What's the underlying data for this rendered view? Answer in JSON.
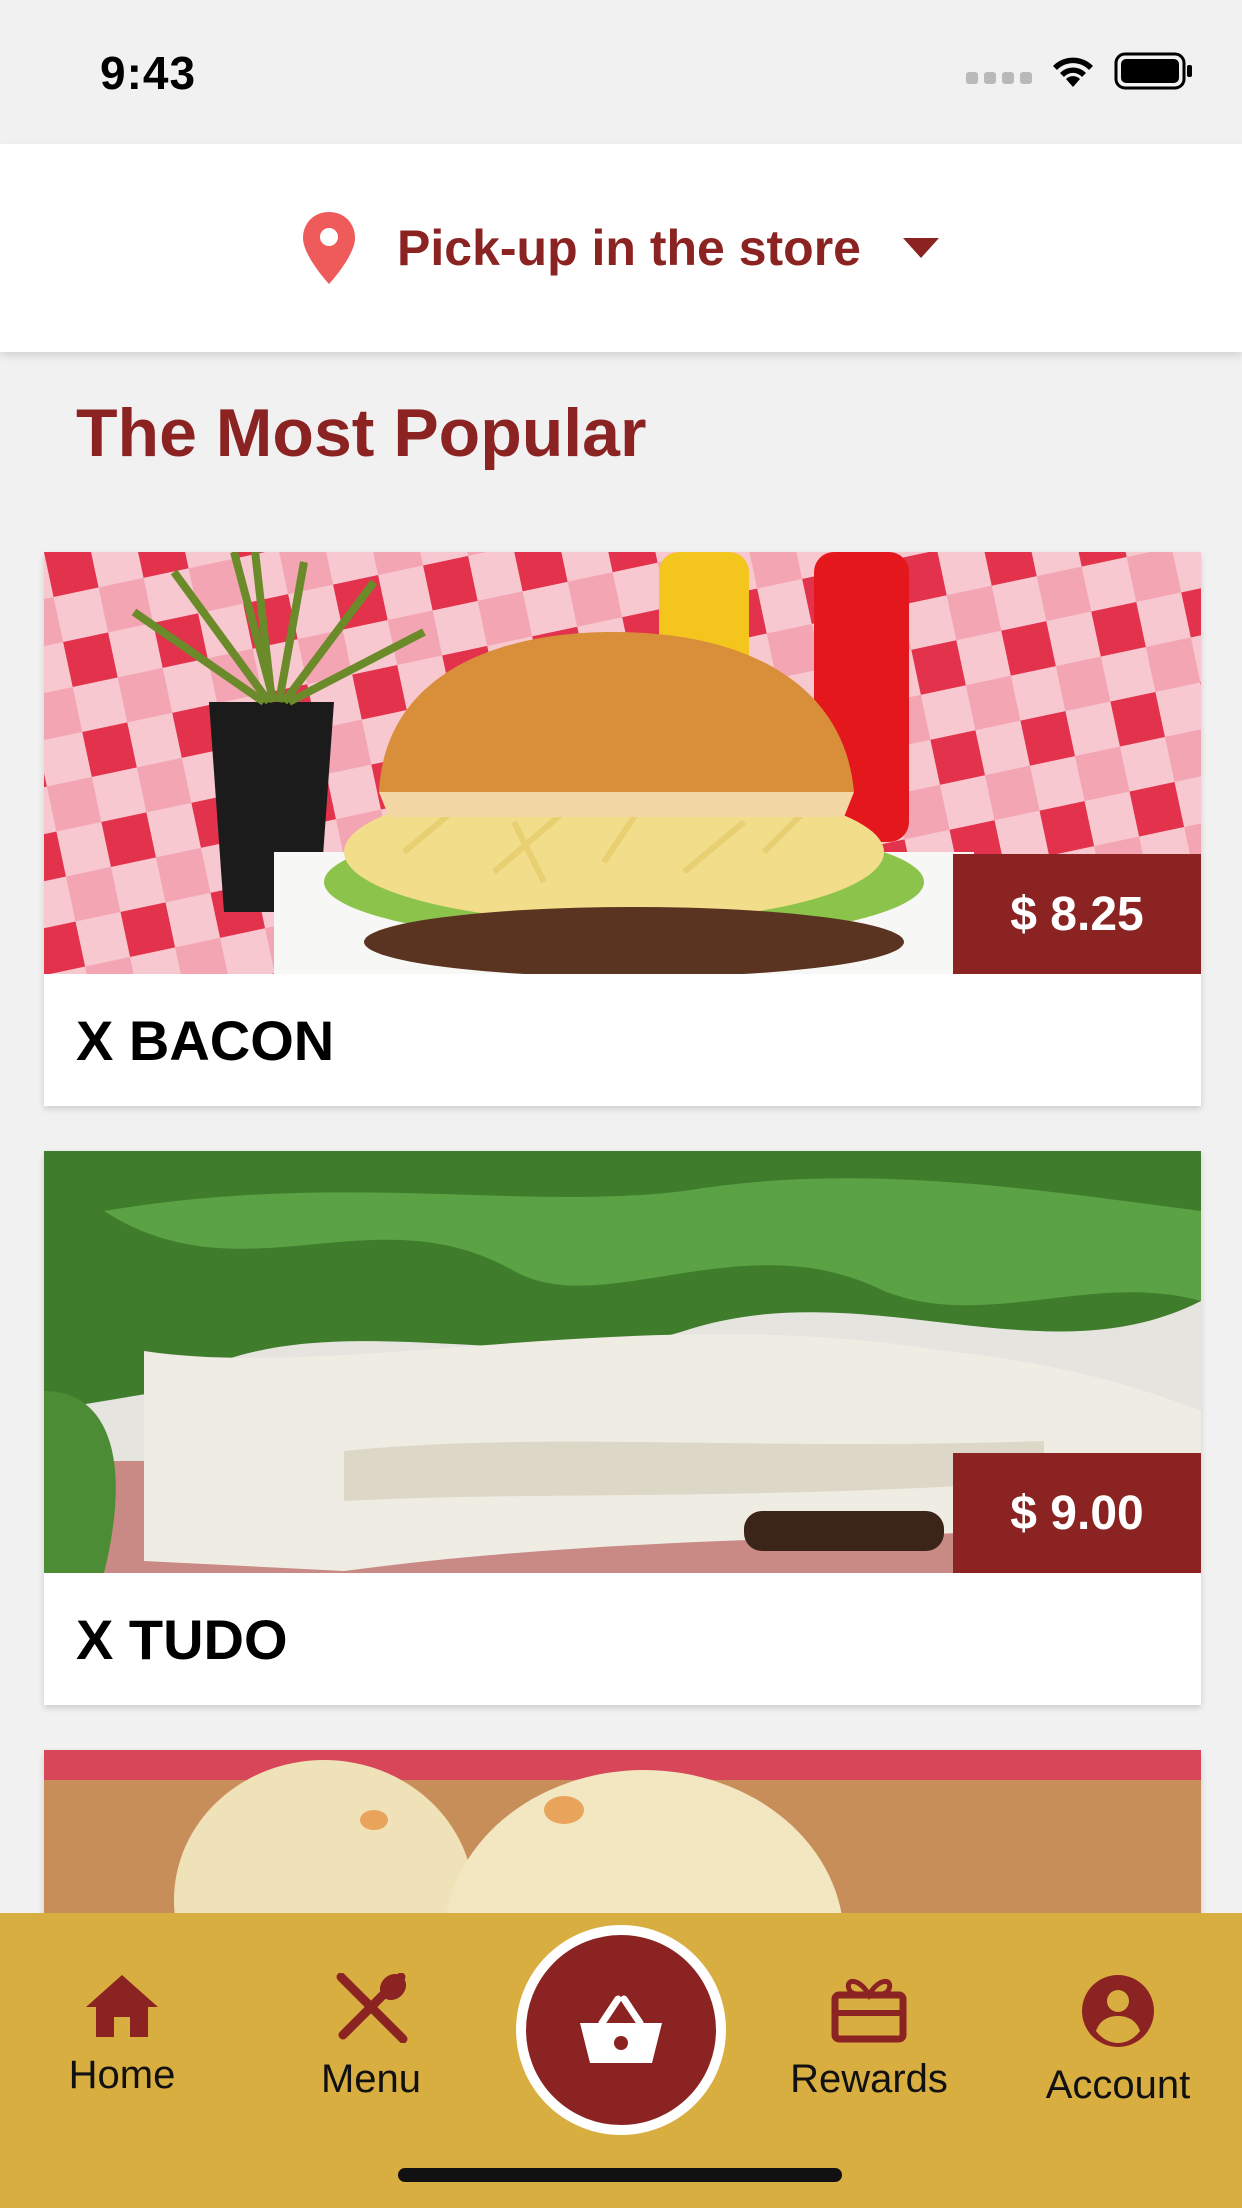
{
  "status": {
    "time": "9:43"
  },
  "pickup": {
    "label": "Pick-up in the store"
  },
  "section": {
    "title": "The Most Popular"
  },
  "items": [
    {
      "name": "X BACON",
      "price": "$ 8.25"
    },
    {
      "name": "X TUDO",
      "price": "$ 9.00"
    }
  ],
  "nav": {
    "home": "Home",
    "menu": "Menu",
    "rewards": "Rewards",
    "account": "Account"
  },
  "colors": {
    "brand": "#8b2323",
    "nav_bg": "#d9ae41",
    "pin": "#ef5a5a"
  },
  "icons": [
    "wifi-icon",
    "battery-icon",
    "location-pin-icon",
    "chevron-down-icon",
    "home-icon",
    "menu-utensils-icon",
    "basket-icon",
    "gift-icon",
    "account-icon"
  ]
}
